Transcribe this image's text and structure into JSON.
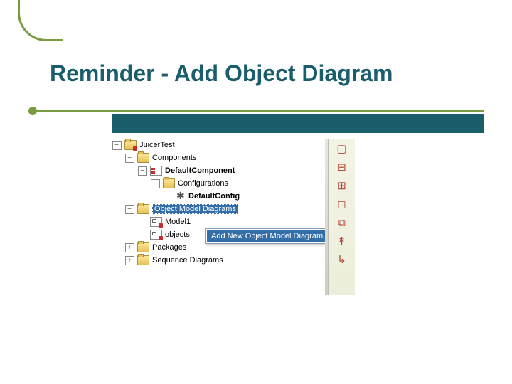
{
  "title": "Reminder - Add Object Diagram",
  "tree": {
    "n0": "JuicerTest",
    "n1": "Components",
    "n2": "DefaultComponent",
    "n3": "Configurations",
    "n4": "DefaultConfig",
    "n5": "Object Model Diagrams",
    "n6": "Model1",
    "n7": "objects",
    "n8": "Packages",
    "n9": "Sequence Diagrams"
  },
  "context_menu": {
    "item0": "Add New Object Model Diagram"
  },
  "toolbar": {
    "i0": "▢",
    "i1": "⊟",
    "i2": "⊞",
    "i3": "◻",
    "i4": "⧉",
    "i5": "↟",
    "i6": "↳"
  }
}
